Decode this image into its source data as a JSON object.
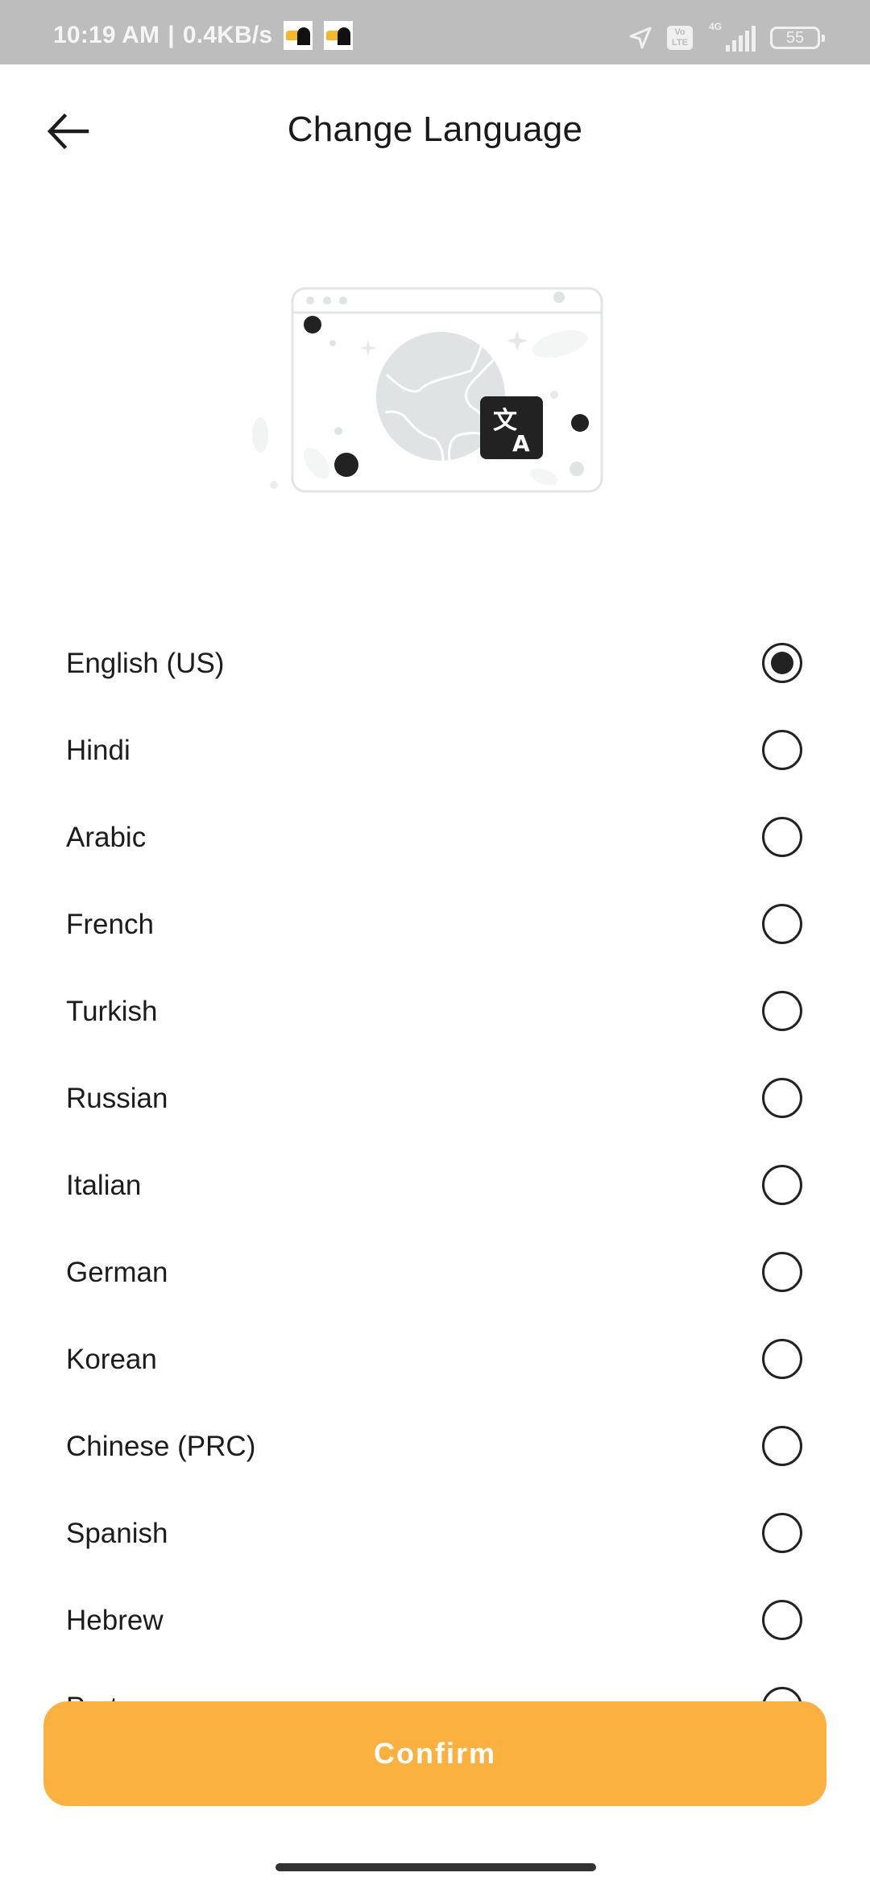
{
  "status_bar": {
    "time": "10:19 AM",
    "separator": "|",
    "net_speed": "0.4KB/s",
    "notification_icons": [
      "taxi-app-icon",
      "taxi-app-icon"
    ],
    "volte_label_top": "Vo",
    "volte_label_bottom": "LTE",
    "network_type": "4G",
    "battery_percent": "55"
  },
  "header": {
    "title": "Change Language",
    "back_icon": "arrow-left-icon"
  },
  "illustration": {
    "description": "translate-illustration",
    "translate_glyph_top": "文",
    "translate_glyph_bottom": "A"
  },
  "languages": {
    "selected": "English (US)",
    "items": [
      {
        "label": "English (US)",
        "checked": true
      },
      {
        "label": "Hindi",
        "checked": false
      },
      {
        "label": "Arabic",
        "checked": false
      },
      {
        "label": "French",
        "checked": false
      },
      {
        "label": "Turkish",
        "checked": false
      },
      {
        "label": "Russian",
        "checked": false
      },
      {
        "label": "Italian",
        "checked": false
      },
      {
        "label": "German",
        "checked": false
      },
      {
        "label": "Korean",
        "checked": false
      },
      {
        "label": "Chinese (PRC)",
        "checked": false
      },
      {
        "label": "Spanish",
        "checked": false
      },
      {
        "label": "Hebrew",
        "checked": false
      },
      {
        "label": "Portuguese",
        "checked": false
      }
    ]
  },
  "footer": {
    "confirm_label": "Confirm"
  },
  "colors": {
    "accent": "#fab13f",
    "status_bar": "#bdbdbd",
    "text": "#1c1c1c"
  }
}
